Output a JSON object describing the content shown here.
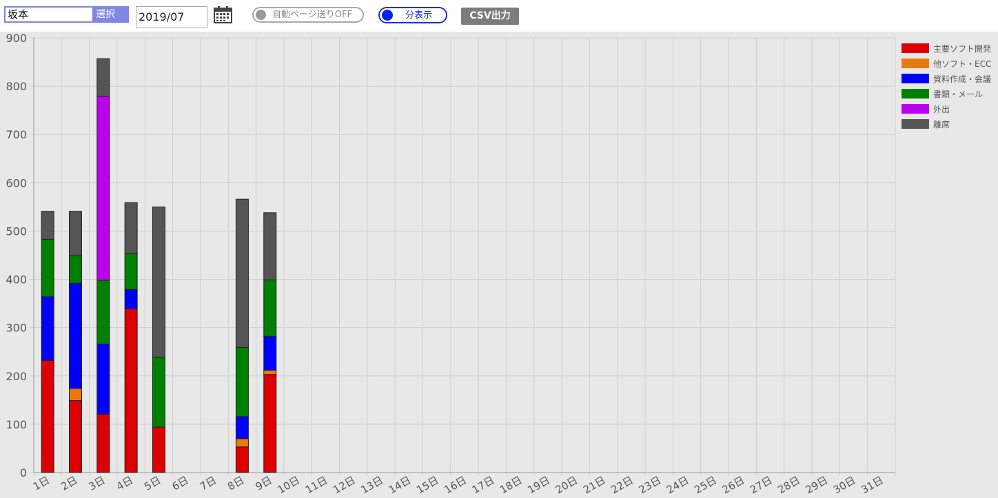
{
  "toolbar": {
    "name_value": "坂本",
    "select_label": "選択",
    "month_value": "2019/07",
    "auto_page_label": "自動ページ送りOFF",
    "minutes_label": "分表示",
    "csv_label": "CSV出力",
    "calendar_icon": "calendar-icon"
  },
  "colors": {
    "plot_background": "#e8e8e8",
    "grid": "#cfcfcf",
    "bar_border": "#222222"
  },
  "chart_data": {
    "type": "bar",
    "stacked": true,
    "categories": [
      "1日",
      "2日",
      "3日",
      "4日",
      "5日",
      "6日",
      "7日",
      "8日",
      "9日",
      "10日",
      "11日",
      "12日",
      "13日",
      "14日",
      "15日",
      "16日",
      "17日",
      "18日",
      "19日",
      "20日",
      "21日",
      "22日",
      "23日",
      "24日",
      "25日",
      "26日",
      "27日",
      "28日",
      "29日",
      "30日",
      "31日"
    ],
    "ylim": [
      0,
      900
    ],
    "yticks": [
      0,
      100,
      200,
      300,
      400,
      500,
      600,
      700,
      800,
      900
    ],
    "grid": true,
    "legend_position": "top-right",
    "series": [
      {
        "name": "主要ソフト開発",
        "color": "#dd0000",
        "values": [
          232,
          149,
          121,
          339,
          94,
          0,
          0,
          53,
          203,
          0,
          0,
          0,
          0,
          0,
          0,
          0,
          0,
          0,
          0,
          0,
          0,
          0,
          0,
          0,
          0,
          0,
          0,
          0,
          0,
          0,
          0
        ]
      },
      {
        "name": "他ソフト・ECC",
        "color": "#e87a10",
        "values": [
          0,
          25,
          0,
          0,
          0,
          0,
          0,
          17,
          9,
          0,
          0,
          0,
          0,
          0,
          0,
          0,
          0,
          0,
          0,
          0,
          0,
          0,
          0,
          0,
          0,
          0,
          0,
          0,
          0,
          0,
          0
        ]
      },
      {
        "name": "資料作成・会議",
        "color": "#0000ff",
        "values": [
          132,
          218,
          145,
          40,
          0,
          0,
          0,
          46,
          70,
          0,
          0,
          0,
          0,
          0,
          0,
          0,
          0,
          0,
          0,
          0,
          0,
          0,
          0,
          0,
          0,
          0,
          0,
          0,
          0,
          0,
          0
        ]
      },
      {
        "name": "書類・メール",
        "color": "#008000",
        "values": [
          119,
          57,
          132,
          74,
          145,
          0,
          0,
          143,
          117,
          0,
          0,
          0,
          0,
          0,
          0,
          0,
          0,
          0,
          0,
          0,
          0,
          0,
          0,
          0,
          0,
          0,
          0,
          0,
          0,
          0,
          0
        ]
      },
      {
        "name": "外出",
        "color": "#bb00ee",
        "values": [
          0,
          0,
          381,
          0,
          0,
          0,
          0,
          0,
          0,
          0,
          0,
          0,
          0,
          0,
          0,
          0,
          0,
          0,
          0,
          0,
          0,
          0,
          0,
          0,
          0,
          0,
          0,
          0,
          0,
          0,
          0
        ]
      },
      {
        "name": "離席",
        "color": "#555555",
        "values": [
          58,
          92,
          78,
          106,
          311,
          0,
          0,
          307,
          139,
          0,
          0,
          0,
          0,
          0,
          0,
          0,
          0,
          0,
          0,
          0,
          0,
          0,
          0,
          0,
          0,
          0,
          0,
          0,
          0,
          0,
          0
        ]
      }
    ]
  }
}
